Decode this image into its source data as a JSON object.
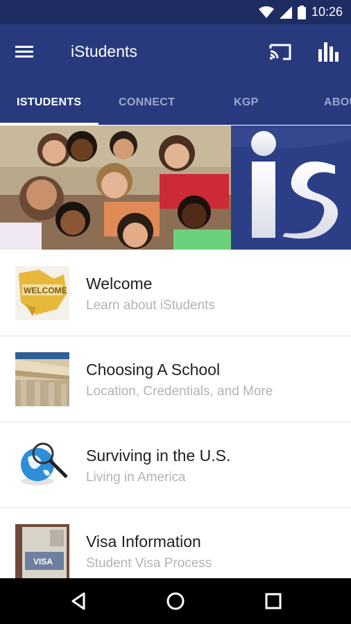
{
  "status_bar": {
    "time": "10:26",
    "icons": [
      "wifi-icon",
      "signal-icon",
      "battery-icon"
    ]
  },
  "app_bar": {
    "title": "iStudents",
    "icons": [
      "menu-icon",
      "cast-icon",
      "bar-chart-icon"
    ]
  },
  "tabs": [
    {
      "label": "ISTUDENTS",
      "active": true
    },
    {
      "label": "CONNECT",
      "active": false
    },
    {
      "label": "KGP",
      "active": false
    },
    {
      "label": "ABOUT",
      "active": false
    }
  ],
  "hero": {
    "logo_text": "is"
  },
  "list": [
    {
      "title": "Welcome",
      "subtitle": "Learn about iStudents",
      "thumb": "welcome-icon"
    },
    {
      "title": "Choosing A School",
      "subtitle": "Location, Credentials, and More",
      "thumb": "university-icon"
    },
    {
      "title": "Surviving in the U.S.",
      "subtitle": "Living in America",
      "thumb": "globe-magnifier-icon"
    },
    {
      "title": "Visa Information",
      "subtitle": "Student Visa Process",
      "thumb": "visa-icon"
    }
  ],
  "nav_bar": {
    "icons": [
      "back-icon",
      "home-icon",
      "recents-icon"
    ]
  },
  "colors": {
    "status_bar": "#1e2c62",
    "app_bar": "#283a7d",
    "tab_inactive": "#9aa6cf",
    "subtitle": "#b3b3b3"
  }
}
